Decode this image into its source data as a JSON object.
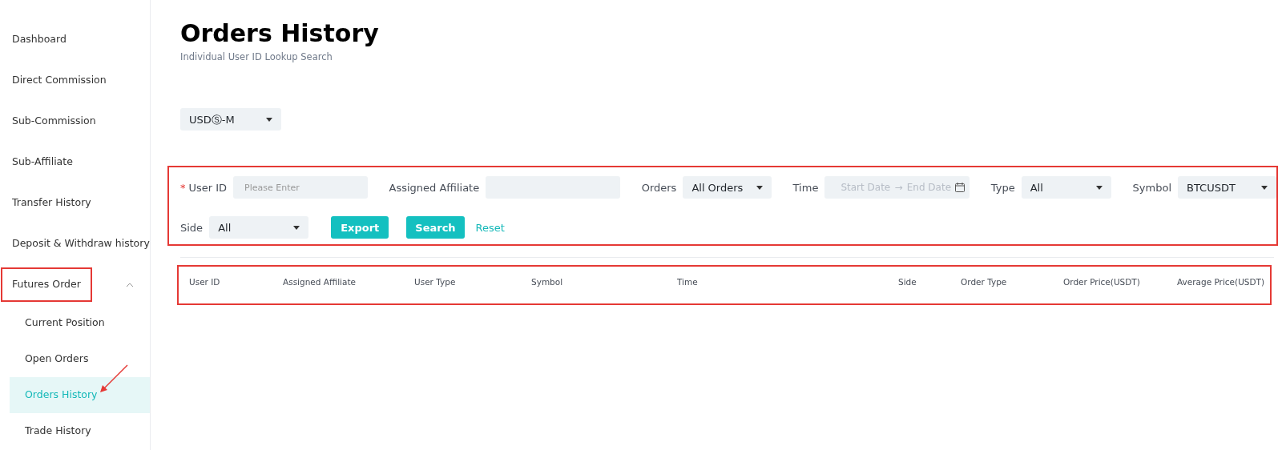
{
  "sidebar": {
    "items": [
      {
        "label": "Dashboard",
        "selected": false,
        "highlighted": false
      },
      {
        "label": "Direct Commission",
        "selected": false,
        "highlighted": false
      },
      {
        "label": "Sub-Commission",
        "selected": false,
        "highlighted": false
      },
      {
        "label": "Sub-Affiliate",
        "selected": false,
        "highlighted": false
      },
      {
        "label": "Transfer History",
        "selected": false,
        "highlighted": false
      },
      {
        "label": "Deposit & Withdraw history",
        "selected": false,
        "highlighted": false
      },
      {
        "label": "Futures Order",
        "selected": false,
        "highlighted": true,
        "expanded": true,
        "children": [
          {
            "label": "Current Position",
            "selected": false
          },
          {
            "label": "Open Orders",
            "selected": false
          },
          {
            "label": "Orders History",
            "selected": true,
            "arrow": true
          },
          {
            "label": "Trade History",
            "selected": false
          }
        ]
      }
    ]
  },
  "page": {
    "title": "Orders History",
    "subtitle": "Individual User ID Lookup Search"
  },
  "market_select": {
    "value": "USDⓈ-M"
  },
  "filters": {
    "highlighted": true,
    "user_id": {
      "label": "User ID",
      "required_mark": "*",
      "placeholder": "Please Enter"
    },
    "assigned_affiliate": {
      "label": "Assigned Affiliate"
    },
    "orders": {
      "label": "Orders",
      "value": "All Orders"
    },
    "time": {
      "label": "Time",
      "start_placeholder": "Start Date",
      "separator": "→",
      "end_placeholder": "End Date"
    },
    "type": {
      "label": "Type",
      "value": "All"
    },
    "symbol": {
      "label": "Symbol",
      "value": "BTCUSDT"
    },
    "side": {
      "label": "Side",
      "value": "All"
    },
    "buttons": {
      "export": "Export",
      "search": "Search",
      "reset": "Reset"
    }
  },
  "table": {
    "highlighted": true,
    "columns": [
      "User ID",
      "Assigned Affiliate",
      "User Type",
      "Symbol",
      "Time",
      "Side",
      "Order Type",
      "Order Price(USDT)",
      "Average Price(USDT)"
    ]
  }
}
